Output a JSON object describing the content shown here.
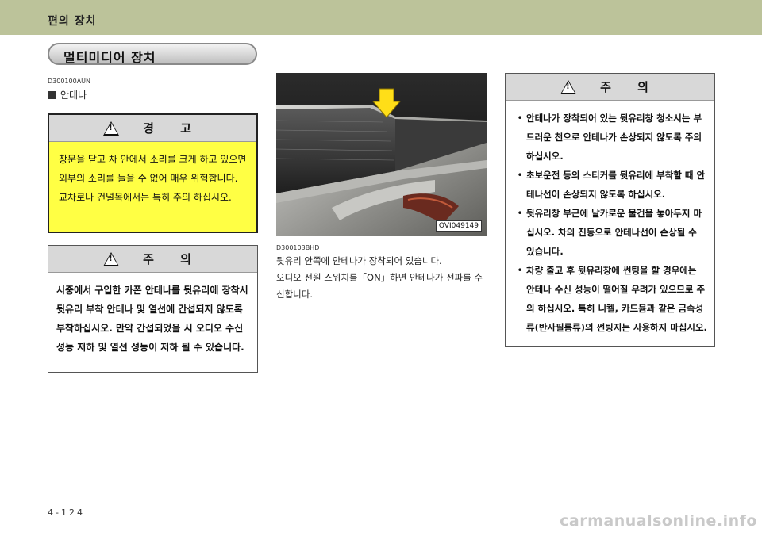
{
  "header": {
    "title": "편의 장치"
  },
  "section": {
    "title": "멀티미디어 장치"
  },
  "antenna": {
    "code": "D300100AUN",
    "heading": "안테나"
  },
  "warning": {
    "title": "경 고",
    "text": "창문을 닫고 차 안에서 소리를 크게 하고 있으면 외부의 소리를 들을 수 없어 매우 위험합니다. 교차로나 건널목에서는 특히 주의 하십시오."
  },
  "caution_left": {
    "title": "주 의",
    "text": "시중에서 구입한 카폰 안테나를 뒷유리에 장착시 뒷유리 부착 안테나 및 열선에 간섭되지 않도록 부착하십시오. 만약 간섭되었을 시 오디오 수신 성능 저하 및 열선 성능이 저하 될 수 있습니다."
  },
  "photo": {
    "label": "OVI049149"
  },
  "caption": {
    "code": "D300103BHD",
    "lines": [
      "뒷유리 안쪽에 안테나가 장착되어 있습니다.",
      "오디오 전원 스위치를「ON」하면 안테나가 전파를 수신합니다."
    ]
  },
  "caution_right": {
    "title": "주 의",
    "items": [
      "안테나가 장착되어 있는 뒷유리창 청소시는 부드러운 천으로 안테나가 손상되지 않도록 주의하십시오.",
      "초보운전 등의 스티커를 뒷유리에 부착할 때 안테나선이 손상되지 않도록 하십시오.",
      "뒷유리창 부근에 날카로운 물건을 놓아두지 마십시오. 차의 진동으로 안테나선이 손상될 수 있습니다.",
      "차량 출고 후 뒷유리창에 썬팅을 할 경우에는 안테나 수신 성능이 떨어질 우려가 있으므로 주의 하십시오. 특히 니켈, 카드뮴과 같은 금속성류(반사필름류)의 썬팅지는 사용하지 마십시오."
    ]
  },
  "footer": {
    "page": "4-124",
    "watermark": "carmanualsonline.info"
  },
  "colors": {
    "header_bg": "#bcc39a",
    "warning_bg": "#ffff44",
    "box_head_bg": "#d8d8d8"
  }
}
